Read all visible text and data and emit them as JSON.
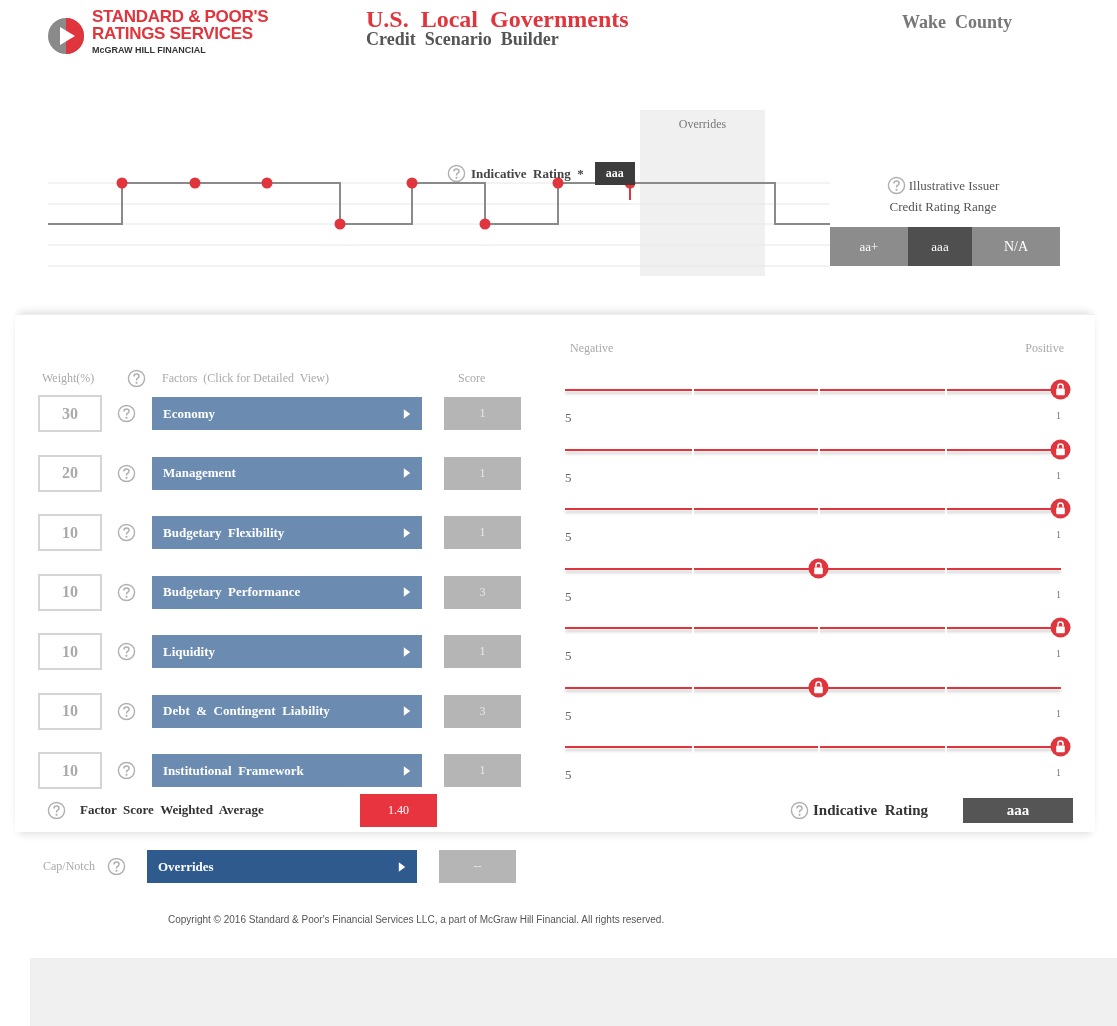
{
  "header": {
    "logo_lines": [
      "STANDARD & POOR'S",
      "RATINGS SERVICES",
      "McGRAW HILL FINANCIAL"
    ],
    "title": "U.S.  Local  Governments",
    "subtitle": "Credit  Scenario  Builder",
    "entity": "Wake  County"
  },
  "rating_chart": {
    "overrides_label": "Overrides",
    "indicative_label": "Indicative  Rating  *",
    "indicative_value": "aaa",
    "range_label_lines": [
      "Illustrative  Issuer",
      "Credit  Rating  Range"
    ],
    "range": [
      {
        "label": "aa+",
        "selected": false
      },
      {
        "label": "aaa",
        "selected": true
      },
      {
        "label": "N/A",
        "selected": false
      }
    ]
  },
  "factors": {
    "columns": {
      "weight": "Weight(%)",
      "factor": "Factors  (Click for Detailed  View)",
      "score": "Score"
    },
    "scale": {
      "left": "Negative",
      "right": "Positive"
    },
    "rows": [
      {
        "weight": "30",
        "name": "Economy",
        "score": "1",
        "min": "5",
        "max": "1",
        "level": 1
      },
      {
        "weight": "20",
        "name": "Management",
        "score": "1",
        "min": "5",
        "max": "1",
        "level": 1
      },
      {
        "weight": "10",
        "name": "Budgetary  Flexibility",
        "score": "1",
        "min": "5",
        "max": "1",
        "level": 1
      },
      {
        "weight": "10",
        "name": "Budgetary  Performance",
        "score": "3",
        "min": "5",
        "max": "1",
        "level": 0.5
      },
      {
        "weight": "10",
        "name": "Liquidity",
        "score": "1",
        "min": "5",
        "max": "1",
        "level": 1
      },
      {
        "weight": "10",
        "name": "Debt  &  Contingent  Liability",
        "score": "3",
        "min": "5",
        "max": "1",
        "level": 0.5
      },
      {
        "weight": "10",
        "name": "Institutional  Framework",
        "score": "1",
        "min": "5",
        "max": "1",
        "level": 1
      }
    ]
  },
  "summary": {
    "label": "Factor  Score  Weighted  Average",
    "value": "1.40",
    "rating_label": "Indicative  Rating",
    "rating_value": "aaa"
  },
  "overrides": {
    "label": "Cap/Notch",
    "name": "Overrides",
    "value": "--"
  },
  "footer": "Copyright © 2016 Standard & Poor's Financial Services LLC, a part of McGraw Hill Financial. All rights reserved."
}
